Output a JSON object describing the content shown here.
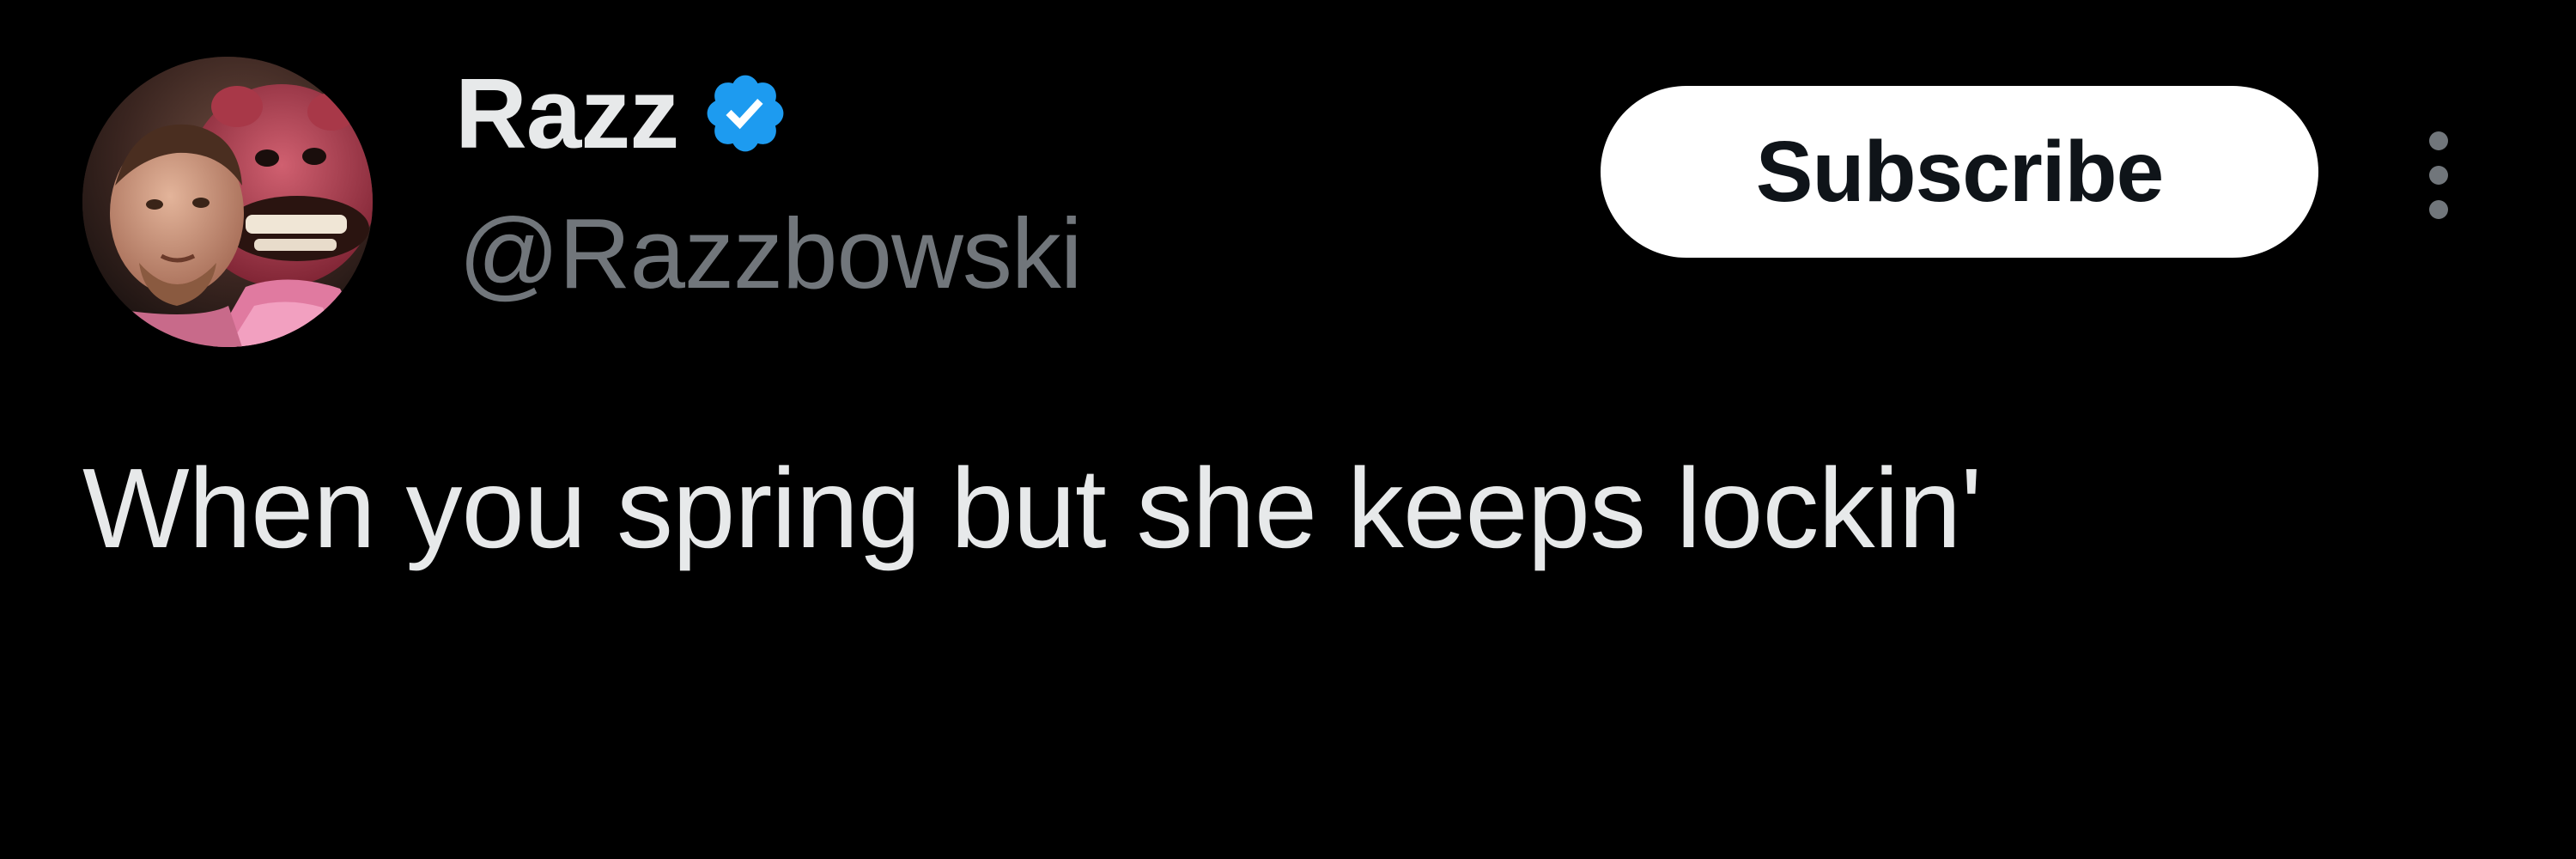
{
  "tweet": {
    "author": {
      "display_name": "Razz",
      "handle": "@Razzbowski",
      "verified": true,
      "verified_badge_color": "#1d9bf0",
      "avatar_icon": "profile-photo-avatar"
    },
    "subscribe_label": "Subscribe",
    "more_icon": "more-options-icon",
    "text": "When you spring but she keeps lockin'"
  },
  "colors": {
    "background": "#000000",
    "primary_text": "#e7e9ea",
    "secondary_text": "#71767b",
    "button_background": "#ffffff",
    "button_text": "#0f1419"
  }
}
